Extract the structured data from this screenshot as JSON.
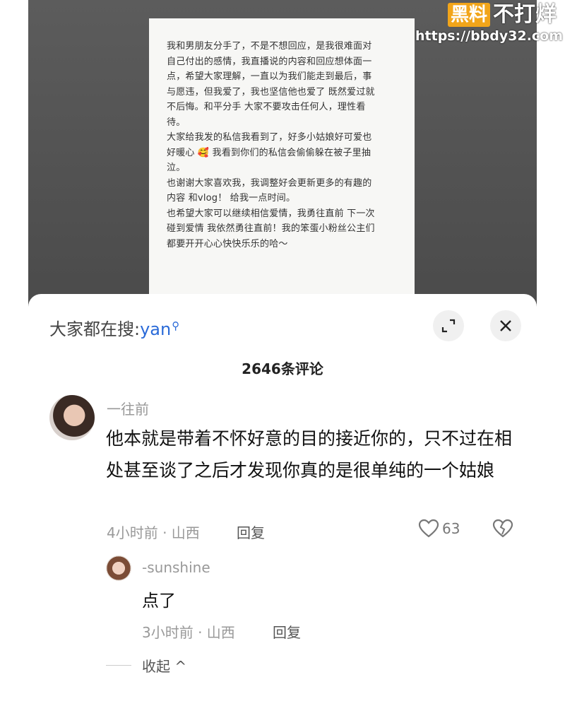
{
  "post": {
    "text": "我和男朋友分手了，不是不想回应，是我很难面对\n自己付出的感情，我直播说的内容和回应想体面一\n点，希望大家理解，一直以为我们能走到最后，事\n与愿违，但我爱了，我也坚信他也爱了 既然爱过就\n不后悔。和平分手 大家不要攻击任何人，理性看\n待。\n大家给我发的私信我看到了，好多小姑娘好可爱也\n好暖心 🥰 我看到你们的私信会偷偷躲在被子里抽\n泣。\n也谢谢大家喜欢我，我调整好会更新更多的有趣的\n内容 和vlog！ 给我一点时间。\n也希望大家可以继续相信爱情，我勇往直前 下一次\n碰到爱情 我依然勇往直前！我的笨蛋小粉丝公主们\n都要开开心心快快乐乐的哈～"
  },
  "watermark": {
    "badge": "黑料",
    "rest": "不打烊",
    "url": "https://bbdy32.com"
  },
  "sheet": {
    "search_prefix": "大家都在搜:",
    "search_query": "yan",
    "comment_count": "2646条评论"
  },
  "comment": {
    "username": "一往前",
    "text": "他本就是带着不怀好意的目的接近你的，只不过在相处甚至谈了之后才发现你真的是很单纯的一个姑娘",
    "meta": "4小时前 · 山西",
    "reply_label": "回复",
    "likes": "63"
  },
  "reply": {
    "username": "-sunshine",
    "text": "点了",
    "meta": "3小时前 · 山西",
    "reply_label": "回复"
  },
  "collapse_label": "收起 ^",
  "icons": {
    "expand": "expand-icon",
    "close": "close-icon",
    "like": "heart-icon",
    "dislike": "broken-heart-icon"
  }
}
